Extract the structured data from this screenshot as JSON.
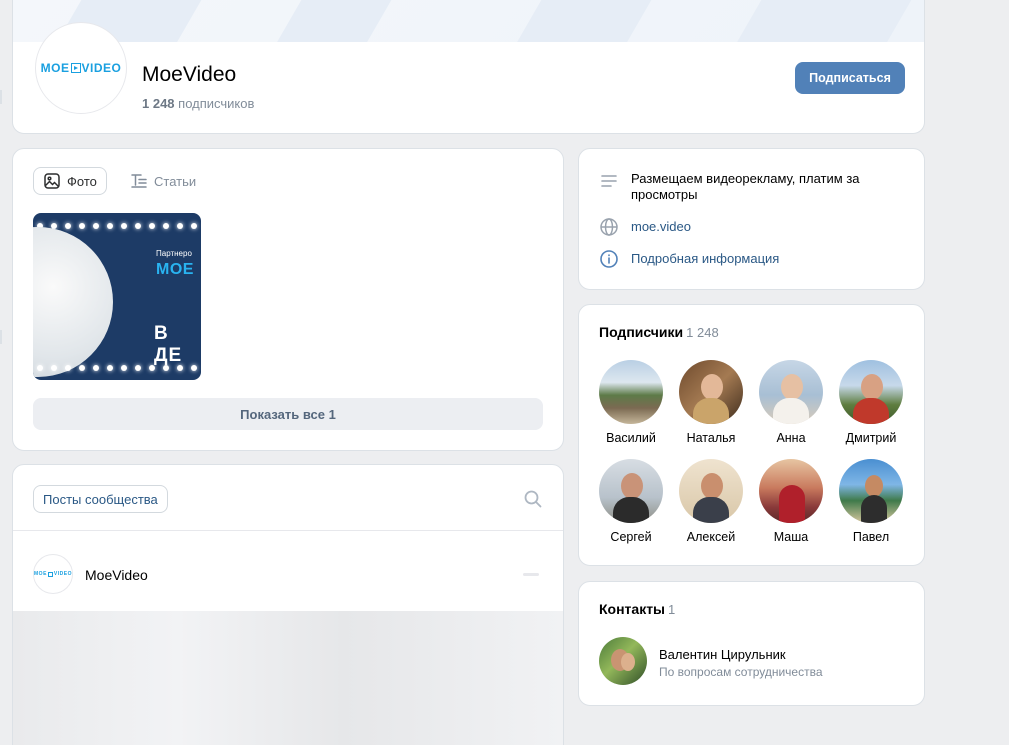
{
  "header": {
    "group_name": "MoeVideo",
    "subscribers_count": "1 248",
    "subscribers_label": "подписчиков",
    "subscribe_button": "Подписаться",
    "logo_left": "MOE",
    "logo_right": "VIDEO"
  },
  "photos": {
    "tabs": [
      {
        "label": "Фото",
        "icon": "image-icon",
        "active": true
      },
      {
        "label": "Статьи",
        "icon": "articles-icon",
        "active": false
      }
    ],
    "thumb_text": {
      "line1": "Партнеро",
      "line2": "МОЕ",
      "line3": "В ДЕ"
    },
    "show_all_button": "Показать все 1"
  },
  "posts": {
    "chip_label": "Посты сообщества",
    "post_author": "MoeVideo",
    "search_icon": "search-icon"
  },
  "info": {
    "description": "Размещаем видеорекламу, платим за просмотры",
    "website": "moe.video",
    "details_link": "Подробная информация"
  },
  "followers": {
    "title": "Подписчики",
    "count": "1 248",
    "people": [
      {
        "name": "Василий"
      },
      {
        "name": "Наталья"
      },
      {
        "name": "Анна"
      },
      {
        "name": "Дмитрий"
      },
      {
        "name": "Сергей"
      },
      {
        "name": "Алексей"
      },
      {
        "name": "Маша"
      },
      {
        "name": "Павел"
      }
    ]
  },
  "contacts": {
    "title": "Контакты",
    "count": "1",
    "person_name": "Валентин Цирульник",
    "person_role": "По вопросам сотрудничества"
  },
  "colors": {
    "accent": "#5181b8",
    "link": "#2a5885",
    "muted": "#818c99",
    "background": "#edeef0"
  }
}
